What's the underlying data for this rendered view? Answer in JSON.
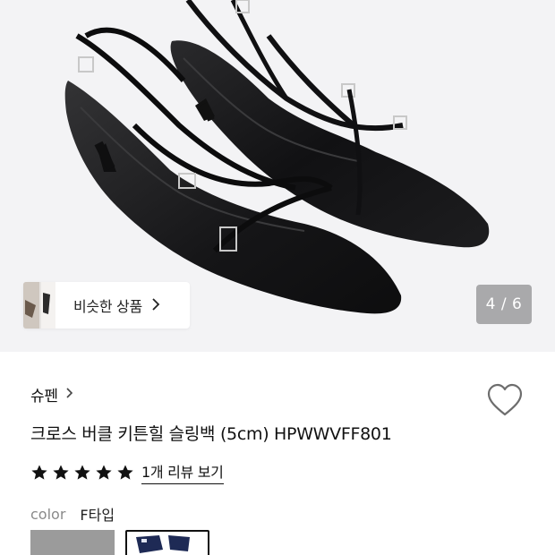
{
  "hero": {
    "similar_button_label": "비슷한 상품",
    "similar_button_chevron": "›",
    "page_indicator": "4 / 6"
  },
  "product": {
    "brand": "슈펜",
    "brand_chevron": "›",
    "title": "크로스 버클 키튼힐 슬링백 (5cm) HPWWVFF801",
    "rating": 5,
    "review_link": "1개 리뷰 보기",
    "color_label": "color",
    "color_value": "F타입"
  },
  "colors": {
    "hero_bg": "#f3f3f5",
    "page_indicator_bg": "#a9a9ab",
    "star": "#111111"
  },
  "icons": {
    "wishlist": "heart-outline-icon",
    "star": "star-icon",
    "chevron": "chevron-right-icon"
  }
}
